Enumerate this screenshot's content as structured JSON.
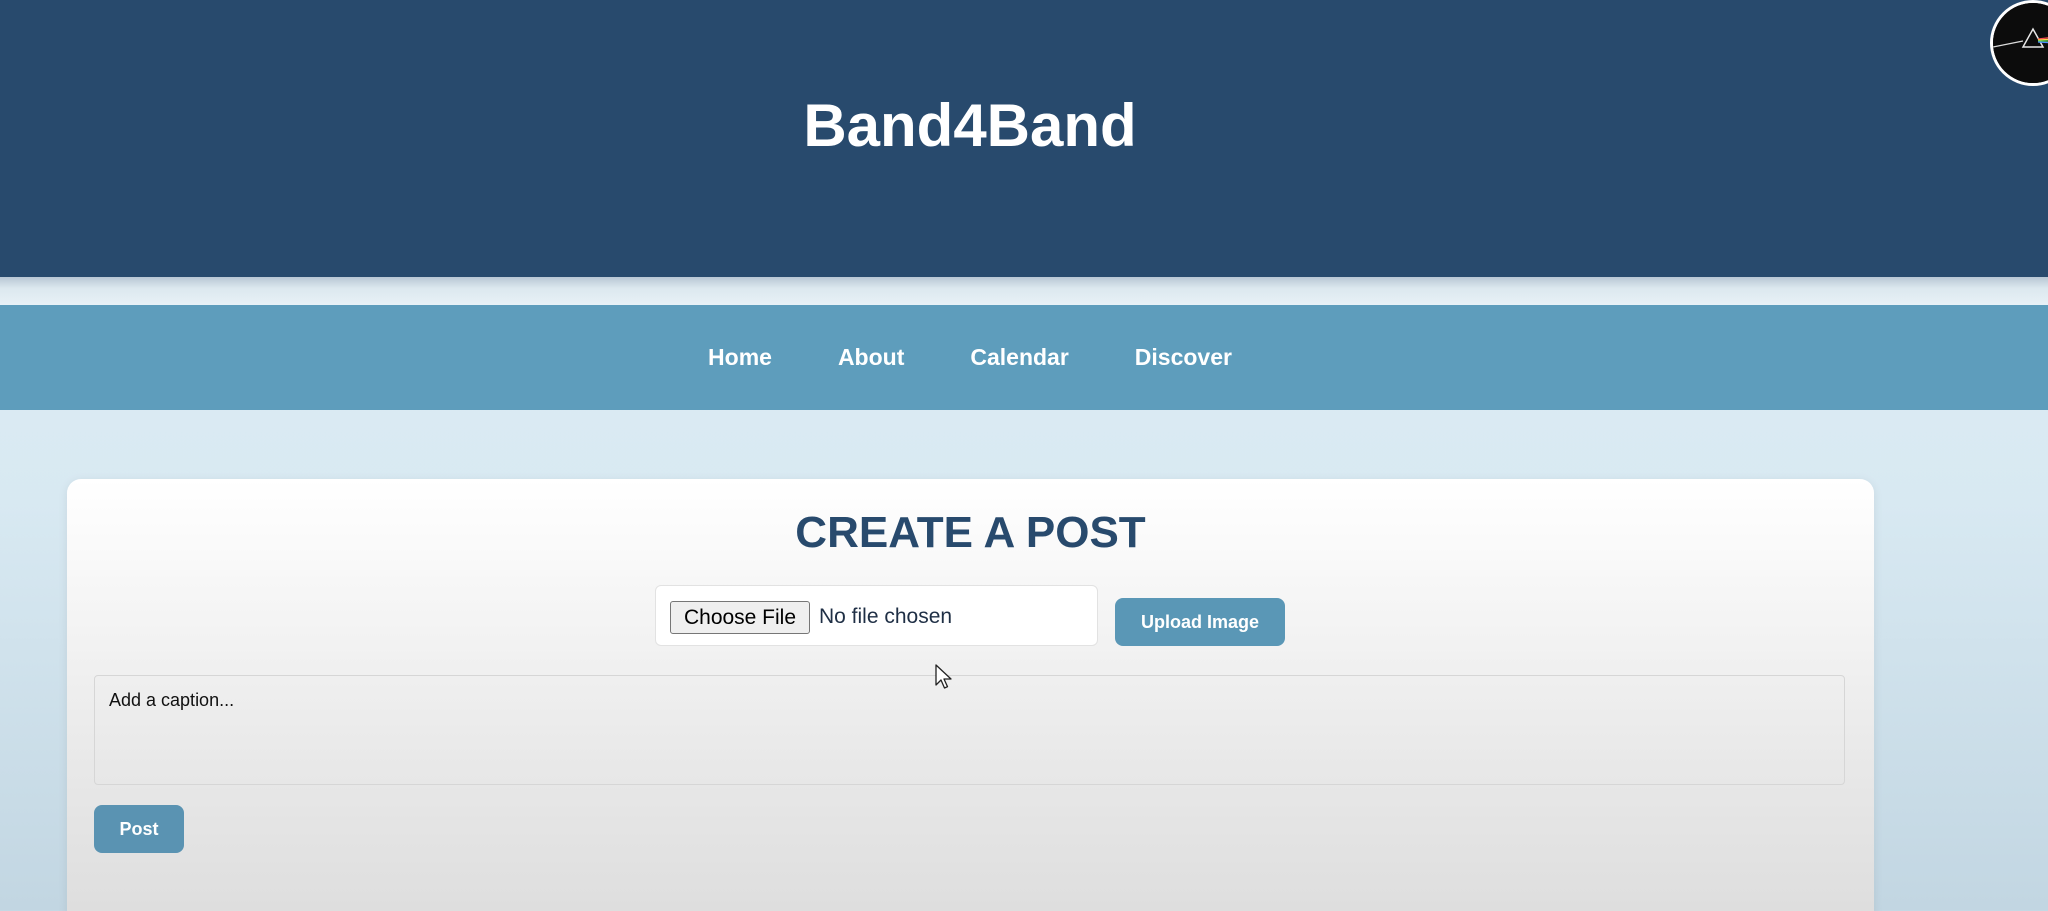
{
  "header": {
    "title": "Band4Band",
    "background": "#284a6d"
  },
  "nav": {
    "items": [
      {
        "label": "Home"
      },
      {
        "label": "About"
      },
      {
        "label": "Calendar"
      },
      {
        "label": "Discover"
      }
    ],
    "background": "#5e9dbc"
  },
  "post_form": {
    "title": "CREATE A POST",
    "choose_file_label": "Choose File",
    "file_status": "No file chosen",
    "upload_label": "Upload Image",
    "caption_placeholder": "Add a caption...",
    "caption_value": "",
    "post_label": "Post",
    "accent": "#5a97b6"
  },
  "icons": {
    "avatar": "profile-avatar",
    "cursor": "mouse-pointer-icon"
  }
}
